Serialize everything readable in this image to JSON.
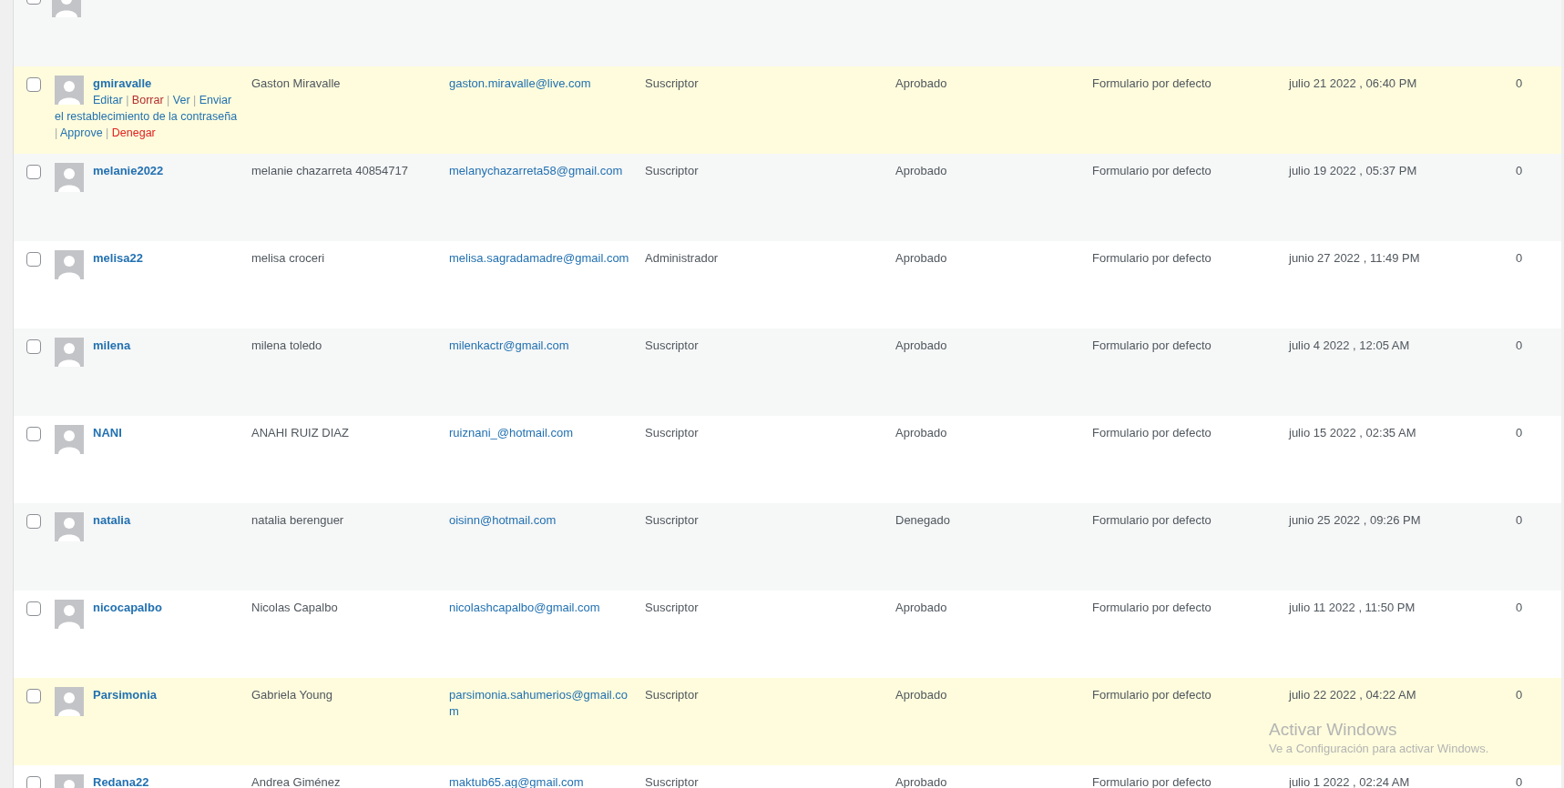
{
  "rows": [
    {
      "kind": "cut_off",
      "highlighted": false,
      "checked": false
    },
    {
      "username": "gmiravalle",
      "name": "Gaston Miravalle",
      "email": "gaston.miravalle@live.com",
      "role": "Suscriptor",
      "status": "Aprobado",
      "form": "Formulario por defecto",
      "date": "julio 21 2022 , 06:40 PM",
      "count": "0",
      "highlighted": true,
      "checked": false,
      "action_separator": "|",
      "actions": [
        {
          "label": "Editar",
          "kind": "normal"
        },
        {
          "label": "Borrar",
          "kind": "delete"
        },
        {
          "label": "Ver",
          "kind": "normal"
        },
        {
          "label": "Enviar el restablecimiento de la contraseña",
          "kind": "normal"
        },
        {
          "label": "Approve",
          "kind": "normal"
        },
        {
          "label": "Denegar",
          "kind": "deny"
        }
      ]
    },
    {
      "username": "melanie2022",
      "name": "melanie chazarreta 40854717",
      "email": "melanychazarreta58@gmail.com",
      "role": "Suscriptor",
      "status": "Aprobado",
      "form": "Formulario por defecto",
      "date": "julio 19 2022 , 05:37 PM",
      "count": "0",
      "highlighted": false,
      "checked": false
    },
    {
      "username": "melisa22",
      "name": "melisa croceri",
      "email": "melisa.sagradamadre@gmail.com",
      "role": "Administrador",
      "status": "Aprobado",
      "form": "Formulario por defecto",
      "date": "junio 27 2022 , 11:49 PM",
      "count": "0",
      "highlighted": false,
      "checked": false
    },
    {
      "username": "milena",
      "name": "milena toledo",
      "email": "milenkactr@gmail.com",
      "role": "Suscriptor",
      "status": "Aprobado",
      "form": "Formulario por defecto",
      "date": "julio 4 2022 , 12:05 AM",
      "count": "0",
      "highlighted": false,
      "checked": false
    },
    {
      "username": "NANI",
      "name": "ANAHI RUIZ DIAZ",
      "email": "ruiznani_@hotmail.com",
      "role": "Suscriptor",
      "status": "Aprobado",
      "form": "Formulario por defecto",
      "date": "julio 15 2022 , 02:35 AM",
      "count": "0",
      "highlighted": false,
      "checked": false
    },
    {
      "username": "natalia",
      "name": "natalia berenguer",
      "email": "oisinn@hotmail.com",
      "role": "Suscriptor",
      "status": "Denegado",
      "form": "Formulario por defecto",
      "date": "junio 25 2022 , 09:26 PM",
      "count": "0",
      "highlighted": false,
      "checked": false
    },
    {
      "username": "nicocapalbo",
      "name": "Nicolas Capalbo",
      "email": "nicolashcapalbo@gmail.com",
      "role": "Suscriptor",
      "status": "Aprobado",
      "form": "Formulario por defecto",
      "date": "julio 11 2022 , 11:50 PM",
      "count": "0",
      "highlighted": false,
      "checked": false
    },
    {
      "username": "Parsimonia",
      "name": "Gabriela Young",
      "email": "parsimonia.sahumerios@gmail.com",
      "role": "Suscriptor",
      "status": "Aprobado",
      "form": "Formulario por defecto",
      "date": "julio 22 2022 , 04:22 AM",
      "count": "0",
      "highlighted": true,
      "checked": false
    },
    {
      "username": "Redana22",
      "name": "Andrea Giménez",
      "email": "maktub65.ag@gmail.com",
      "role": "Suscriptor",
      "status": "Aprobado",
      "form": "Formulario por defecto",
      "date": "julio 1 2022 , 02:24 AM",
      "count": "0",
      "highlighted": false,
      "checked": false
    }
  ],
  "windows_activation": {
    "title": "Activar Windows",
    "subtitle": "Ve a Configuración para activar Windows."
  }
}
